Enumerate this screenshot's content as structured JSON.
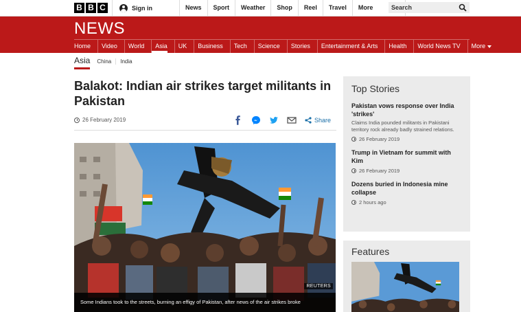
{
  "topbar": {
    "logo_letters": [
      "B",
      "B",
      "C"
    ],
    "signin_label": "Sign in",
    "nav": [
      "News",
      "Sport",
      "Weather",
      "Shop",
      "Reel",
      "Travel"
    ],
    "more_label": "More",
    "search_placeholder": "Search"
  },
  "header": {
    "title": "NEWS",
    "nav": [
      {
        "label": "Home",
        "active": false
      },
      {
        "label": "Video",
        "active": false
      },
      {
        "label": "World",
        "active": false
      },
      {
        "label": "Asia",
        "active": true
      },
      {
        "label": "UK",
        "active": false
      },
      {
        "label": "Business",
        "active": false
      },
      {
        "label": "Tech",
        "active": false
      },
      {
        "label": "Science",
        "active": false
      },
      {
        "label": "Stories",
        "active": false
      },
      {
        "label": "Entertainment & Arts",
        "active": false
      },
      {
        "label": "Health",
        "active": false
      },
      {
        "label": "World News TV",
        "active": false
      },
      {
        "label": "More",
        "active": false
      }
    ],
    "accent_color": "#bb1919"
  },
  "subnav": {
    "section": "Asia",
    "items": [
      "China",
      "India"
    ]
  },
  "article": {
    "headline": "Balakot: Indian air strikes target militants in Pakistan",
    "date": "26 February 2019",
    "share_label": "Share",
    "share_icons": [
      "facebook-icon",
      "messenger-icon",
      "twitter-icon",
      "email-icon",
      "share-icon"
    ],
    "image_credit": "REUTERS",
    "image_caption": "Some Indians took to the streets, burning an effigy of Pakistan, after news of the air strikes broke"
  },
  "sidebar": {
    "top_stories_title": "Top Stories",
    "stories": [
      {
        "title": "Pakistan vows response over India 'strikes'",
        "summary": "Claims India pounded militants in Pakistani territory rock already badly strained relations.",
        "date": "26 February 2019"
      },
      {
        "title": "Trump in Vietnam for summit with Kim",
        "summary": "",
        "date": "26 February 2019"
      },
      {
        "title": "Dozens buried in Indonesia mine collapse",
        "summary": "",
        "date": "2 hours ago"
      }
    ],
    "features_title": "Features"
  }
}
